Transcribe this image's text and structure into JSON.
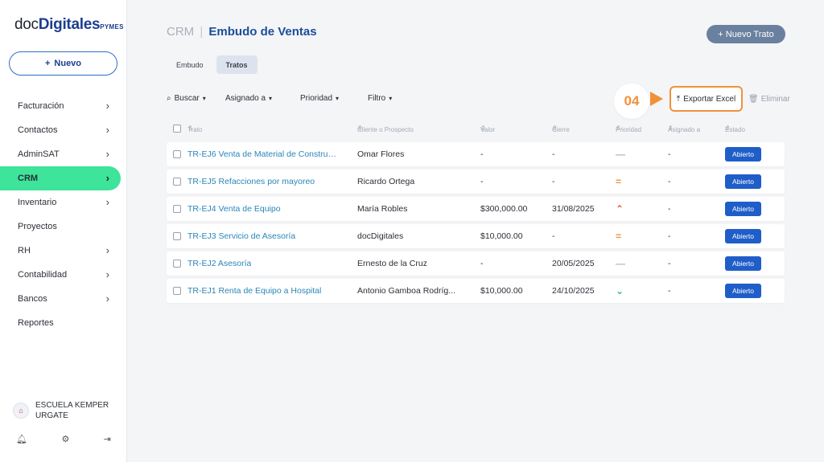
{
  "brand": {
    "prefix": "doc",
    "bold": "Digitales",
    "suffix": "PYMES"
  },
  "sidebar": {
    "new_label": "Nuevo",
    "items": [
      {
        "label": "Facturación",
        "has_chevron": true
      },
      {
        "label": "Contactos",
        "has_chevron": true
      },
      {
        "label": "AdminSAT",
        "has_chevron": true
      },
      {
        "label": "CRM",
        "has_chevron": true,
        "active": true
      },
      {
        "label": "Inventario",
        "has_chevron": true
      },
      {
        "label": "Proyectos",
        "has_chevron": false
      },
      {
        "label": "RH",
        "has_chevron": true
      },
      {
        "label": "Contabilidad",
        "has_chevron": true
      },
      {
        "label": "Bancos",
        "has_chevron": true
      },
      {
        "label": "Reportes",
        "has_chevron": false
      }
    ],
    "org_name": "ESCUELA KEMPER URGATE"
  },
  "header": {
    "crumb_root": "CRM",
    "crumb_sep": "|",
    "title": "Embudo de Ventas",
    "new_deal_label": "Nuevo Trato"
  },
  "tabs": [
    {
      "label": "Embudo",
      "active": false
    },
    {
      "label": "Tratos",
      "active": true
    }
  ],
  "toolbar": {
    "search_label": "Buscar",
    "assigned_label": "Asignado a",
    "priority_label": "Prioridad",
    "filter_label": "Filtro",
    "export_label": "Exportar Excel",
    "delete_label": "Eliminar",
    "step_badge": "04"
  },
  "table": {
    "headers": [
      "Trato",
      "Cliente o Prospecto",
      "Valor",
      "Cierre",
      "Prioridad",
      "Asignado a",
      "Estado"
    ],
    "rows": [
      {
        "deal": "TR-EJ6 Venta de Material de Construcci...",
        "client": "Omar Flores",
        "value": "-",
        "close": "-",
        "priority": "none",
        "assigned": "-",
        "status": "Abierto"
      },
      {
        "deal": "TR-EJ5 Refacciones por mayoreo",
        "client": "Ricardo Ortega",
        "value": "-",
        "close": "-",
        "priority": "medium",
        "assigned": "-",
        "status": "Abierto"
      },
      {
        "deal": "TR-EJ4 Venta de Equipo",
        "client": "María Robles",
        "value": "$300,000.00",
        "close": "31/08/2025",
        "priority": "high",
        "assigned": "-",
        "status": "Abierto"
      },
      {
        "deal": "TR-EJ3 Servicio de Asesoría",
        "client": "docDigitales",
        "value": "$10,000.00",
        "close": "-",
        "priority": "medium",
        "assigned": "-",
        "status": "Abierto"
      },
      {
        "deal": "TR-EJ2 Asesoría",
        "client": "Ernesto de la Cruz",
        "value": "-",
        "close": "20/05/2025",
        "priority": "none",
        "assigned": "-",
        "status": "Abierto"
      },
      {
        "deal": "TR-EJ1 Renta de Equipo a Hospital",
        "client": "Antonio Gamboa Rodríg...",
        "value": "$10,000.00",
        "close": "24/10/2025",
        "priority": "low",
        "assigned": "-",
        "status": "Abierto"
      }
    ]
  },
  "colors": {
    "accent": "#3de49a",
    "primary": "#1f5ec9",
    "highlight": "#f0913a",
    "link": "#2a86b8"
  }
}
